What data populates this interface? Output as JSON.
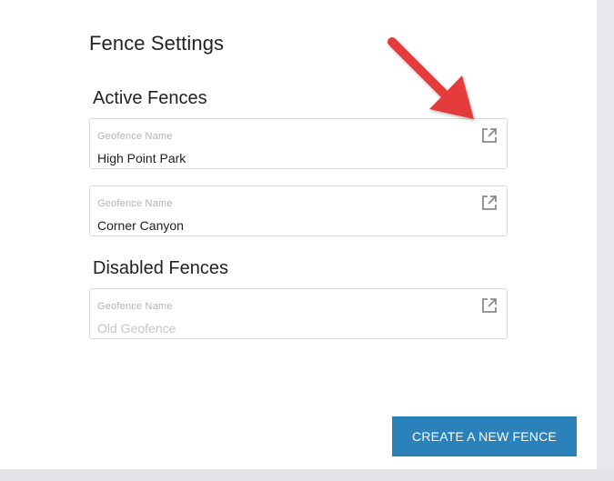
{
  "page": {
    "title": "Fence Settings"
  },
  "sections": {
    "active_title": "Active Fences",
    "disabled_title": "Disabled Fences"
  },
  "fences": {
    "active": [
      {
        "label": "Geofence Name",
        "name": "High Point Park"
      },
      {
        "label": "Geofence Name",
        "name": "Corner Canyon"
      }
    ],
    "disabled": [
      {
        "label": "Geofence Name",
        "name": "Old Geofence"
      }
    ]
  },
  "icons": {
    "edit": "open-in-new-icon",
    "annotation": "red-arrow-pointer"
  },
  "actions": {
    "create_label": "CREATE A NEW FENCE"
  },
  "colors": {
    "primary_button": "#2b82bb",
    "annotation_arrow": "#e53a3a",
    "disabled_text": "#c6c6c6"
  }
}
